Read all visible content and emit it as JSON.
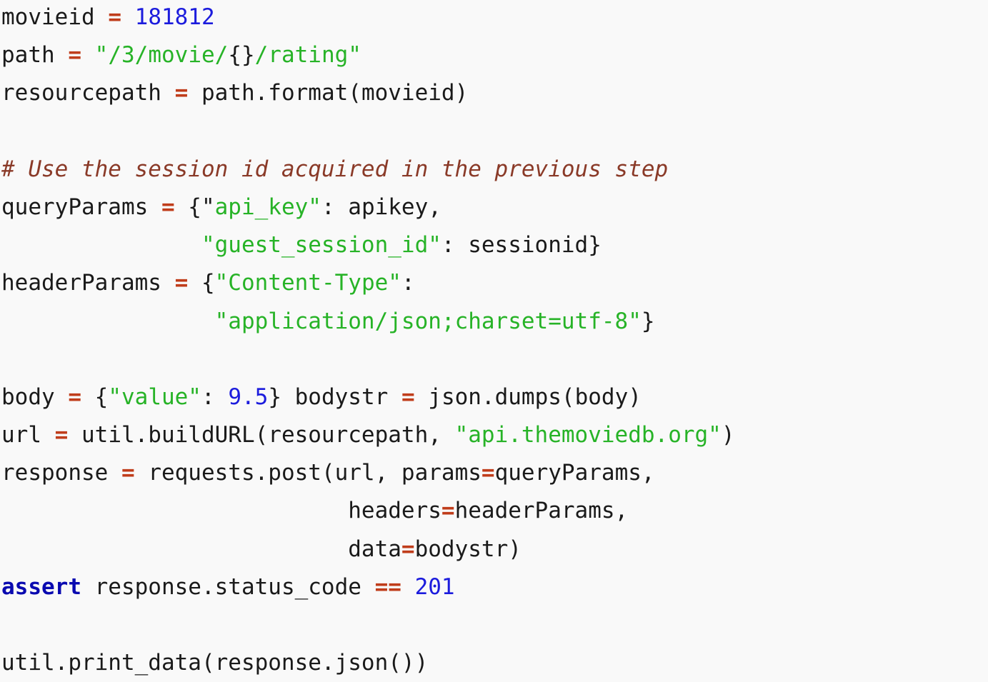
{
  "document": {
    "type": "python-code-listing",
    "language": "Python",
    "background_color": "#f9f9f9",
    "colors": {
      "identifier": "#1a1a1a",
      "operator": "#c03d1b",
      "number": "#1c1cdd",
      "string": "#27b327",
      "comment": "#8a3a28",
      "keyword": "#0a0ab0",
      "punctuation": "#1a1a1a"
    }
  },
  "code": {
    "lines": [
      {
        "id": "line-1",
        "tokens": [
          {
            "t": "movieid ",
            "k": "name"
          },
          {
            "t": "=",
            "k": "op"
          },
          {
            "t": " ",
            "k": "name"
          },
          {
            "t": "181812",
            "k": "num"
          }
        ]
      },
      {
        "id": "line-2",
        "tokens": [
          {
            "t": "path ",
            "k": "name"
          },
          {
            "t": "=",
            "k": "op"
          },
          {
            "t": " ",
            "k": "name"
          },
          {
            "t": "\"/3/movie/",
            "k": "str"
          },
          {
            "t": "{}",
            "k": "str-dark"
          },
          {
            "t": "/rating\"",
            "k": "str"
          }
        ]
      },
      {
        "id": "line-3",
        "tokens": [
          {
            "t": "resourcepath ",
            "k": "name"
          },
          {
            "t": "=",
            "k": "op"
          },
          {
            "t": " path.format(movieid)",
            "k": "name"
          }
        ]
      },
      {
        "id": "line-4",
        "blank": true,
        "tokens": []
      },
      {
        "id": "line-5",
        "tokens": [
          {
            "t": "# Use the session id acquired in the previous step",
            "k": "comment"
          }
        ]
      },
      {
        "id": "line-6",
        "tokens": [
          {
            "t": "queryParams ",
            "k": "name"
          },
          {
            "t": "=",
            "k": "op"
          },
          {
            "t": " {",
            "k": "punct"
          },
          {
            "t": "\"",
            "k": "str-dark"
          },
          {
            "t": "api_key\"",
            "k": "str"
          },
          {
            "t": ": apikey,",
            "k": "name"
          }
        ]
      },
      {
        "id": "line-7",
        "tokens": [
          {
            "t": "               \"guest_session_id\"",
            "k": "str"
          },
          {
            "t": ": sessionid}",
            "k": "name"
          }
        ]
      },
      {
        "id": "line-8",
        "tokens": [
          {
            "t": "headerParams ",
            "k": "name"
          },
          {
            "t": "=",
            "k": "op"
          },
          {
            "t": " {",
            "k": "punct"
          },
          {
            "t": "\"Content-Type\"",
            "k": "str"
          },
          {
            "t": ":",
            "k": "name"
          }
        ]
      },
      {
        "id": "line-9",
        "tokens": [
          {
            "t": "                ",
            "k": "name"
          },
          {
            "t": "\"application/json;charset=utf-8\"",
            "k": "str"
          },
          {
            "t": "}",
            "k": "punct"
          }
        ]
      },
      {
        "id": "line-10",
        "blank": true,
        "tokens": []
      },
      {
        "id": "line-11",
        "tokens": [
          {
            "t": "body ",
            "k": "name"
          },
          {
            "t": "=",
            "k": "op"
          },
          {
            "t": " {",
            "k": "punct"
          },
          {
            "t": "\"value\"",
            "k": "str"
          },
          {
            "t": ": ",
            "k": "name"
          },
          {
            "t": "9.5",
            "k": "num"
          },
          {
            "t": "} bodystr ",
            "k": "name"
          },
          {
            "t": "=",
            "k": "op"
          },
          {
            "t": " json.dumps(body)",
            "k": "name"
          }
        ]
      },
      {
        "id": "line-12",
        "tokens": [
          {
            "t": "url ",
            "k": "name"
          },
          {
            "t": "=",
            "k": "op"
          },
          {
            "t": " util.buildURL(resourcepath, ",
            "k": "name"
          },
          {
            "t": "\"api.themoviedb.org\"",
            "k": "str"
          },
          {
            "t": ")",
            "k": "name"
          }
        ]
      },
      {
        "id": "line-13",
        "tokens": [
          {
            "t": "response ",
            "k": "name"
          },
          {
            "t": "=",
            "k": "op"
          },
          {
            "t": " requests.post(url, params",
            "k": "name"
          },
          {
            "t": "=",
            "k": "op"
          },
          {
            "t": "queryParams,",
            "k": "name"
          }
        ]
      },
      {
        "id": "line-14",
        "tokens": [
          {
            "t": "                          headers",
            "k": "name"
          },
          {
            "t": "=",
            "k": "op"
          },
          {
            "t": "headerParams,",
            "k": "name"
          }
        ]
      },
      {
        "id": "line-15",
        "tokens": [
          {
            "t": "                          data",
            "k": "name"
          },
          {
            "t": "=",
            "k": "op"
          },
          {
            "t": "bodystr)",
            "k": "name"
          }
        ]
      },
      {
        "id": "line-16",
        "tokens": [
          {
            "t": "assert",
            "k": "keyword"
          },
          {
            "t": " response.status_code ",
            "k": "name"
          },
          {
            "t": "==",
            "k": "op"
          },
          {
            "t": " ",
            "k": "name"
          },
          {
            "t": "201",
            "k": "num"
          }
        ]
      },
      {
        "id": "line-17",
        "blank": true,
        "tokens": []
      },
      {
        "id": "line-18",
        "tokens": [
          {
            "t": "util.print_data(response.json())",
            "k": "name"
          }
        ]
      }
    ],
    "plain_text": "movieid = 181812\npath = \"/3/movie/{}/rating\"\nresourcepath = path.format(movieid)\n\n# Use the session id acquired in the previous step\nqueryParams = {\"api_key\": apikey,\n               \"guest_session_id\": sessionid}\nheaderParams = {\"Content-Type\":\n                \"application/json;charset=utf-8\"}\n\nbody = {\"value\": 9.5} bodystr = json.dumps(body)\nurl = util.buildURL(resourcepath, \"api.themoviedb.org\")\nresponse = requests.post(url, params=queryParams,\n                          headers=headerParams,\n                          data=bodystr)\nassert response.status_code == 201\n\nutil.print_data(response.json())"
  }
}
